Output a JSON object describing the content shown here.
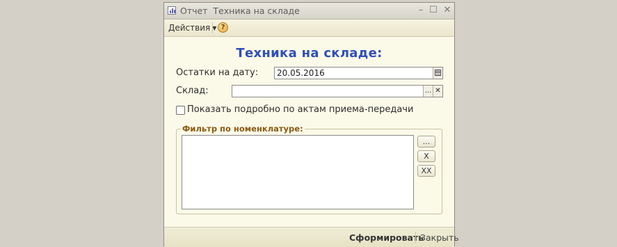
{
  "window": {
    "title": "Отчет  Техника на складе",
    "minimize": "–",
    "maximize": "☐",
    "close": "✕"
  },
  "toolbar": {
    "actions_label": "Действия",
    "actions_caret": "▼",
    "help_label": "?"
  },
  "form": {
    "title": "Техника на складе:",
    "date_label": "Остатки на дату:",
    "date_value": "20.05.2016",
    "warehouse_label": "Склад:",
    "warehouse_value": "",
    "warehouse_select": "...",
    "warehouse_clear": "✕",
    "detail_checkbox_label": "Показать подробно по актам приема-передачи",
    "detail_checked": false
  },
  "filter": {
    "title": "Фильтр по номенклатуре:",
    "items": [],
    "select_button": "...",
    "remove_button": "X",
    "clear_all_button": "XX"
  },
  "footer": {
    "generate_label": "Сформировать",
    "close_label": "Закрыть"
  },
  "colors": {
    "title_blue": "#2e4fb8",
    "group_title": "#8a5a12",
    "window_bg": "#fbf9e8",
    "desktop_bg": "#d4d0c8"
  }
}
